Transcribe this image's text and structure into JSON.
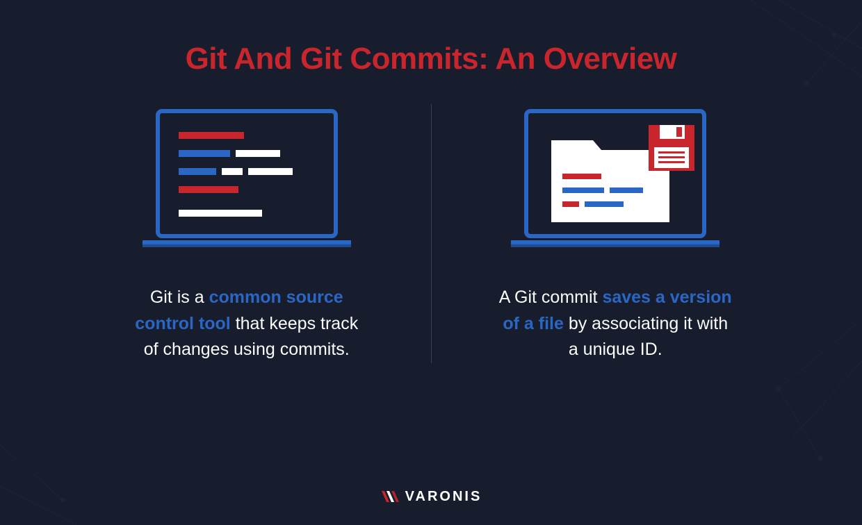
{
  "title": "Git And Git Commits: An Overview",
  "left": {
    "pre": "Git is a ",
    "hl": "common source control tool",
    "post": " that keeps track of changes using commits."
  },
  "right": {
    "pre": "A Git commit ",
    "hl": "saves a version of a file",
    "post": " by associating it with a unique ID."
  },
  "brand": "VARONIS",
  "colors": {
    "red": "#c9252d",
    "blue": "#2a66c4",
    "bg": "#181d2d",
    "white": "#ffffff"
  }
}
